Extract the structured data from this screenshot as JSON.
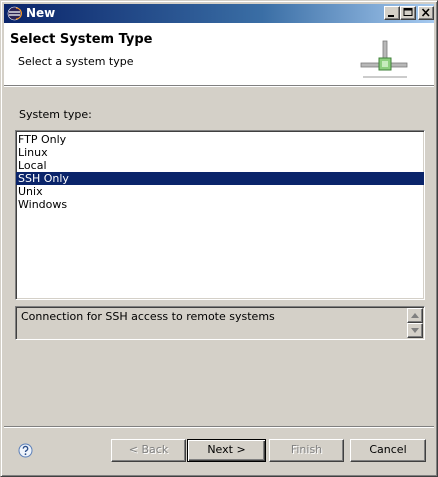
{
  "window": {
    "title": "New"
  },
  "banner": {
    "title": "Select System Type",
    "description": "Select a system type"
  },
  "system_type": {
    "label": "System type:",
    "items": [
      {
        "label": "FTP Only",
        "selected": false
      },
      {
        "label": "Linux",
        "selected": false
      },
      {
        "label": "Local",
        "selected": false
      },
      {
        "label": "SSH Only",
        "selected": true
      },
      {
        "label": "Unix",
        "selected": false
      },
      {
        "label": "Windows",
        "selected": false
      }
    ],
    "description": "Connection for SSH access to remote systems"
  },
  "buttons": {
    "back": "< Back",
    "next": "Next >",
    "finish": "Finish",
    "cancel": "Cancel"
  },
  "colors": {
    "selection": "#0a246a",
    "dialog_bg": "#d4d0c8",
    "banner_bg": "#ffffff"
  },
  "icons": {
    "window": "eclipse-icon",
    "banner": "network-connection-icon",
    "help": "help-icon"
  }
}
